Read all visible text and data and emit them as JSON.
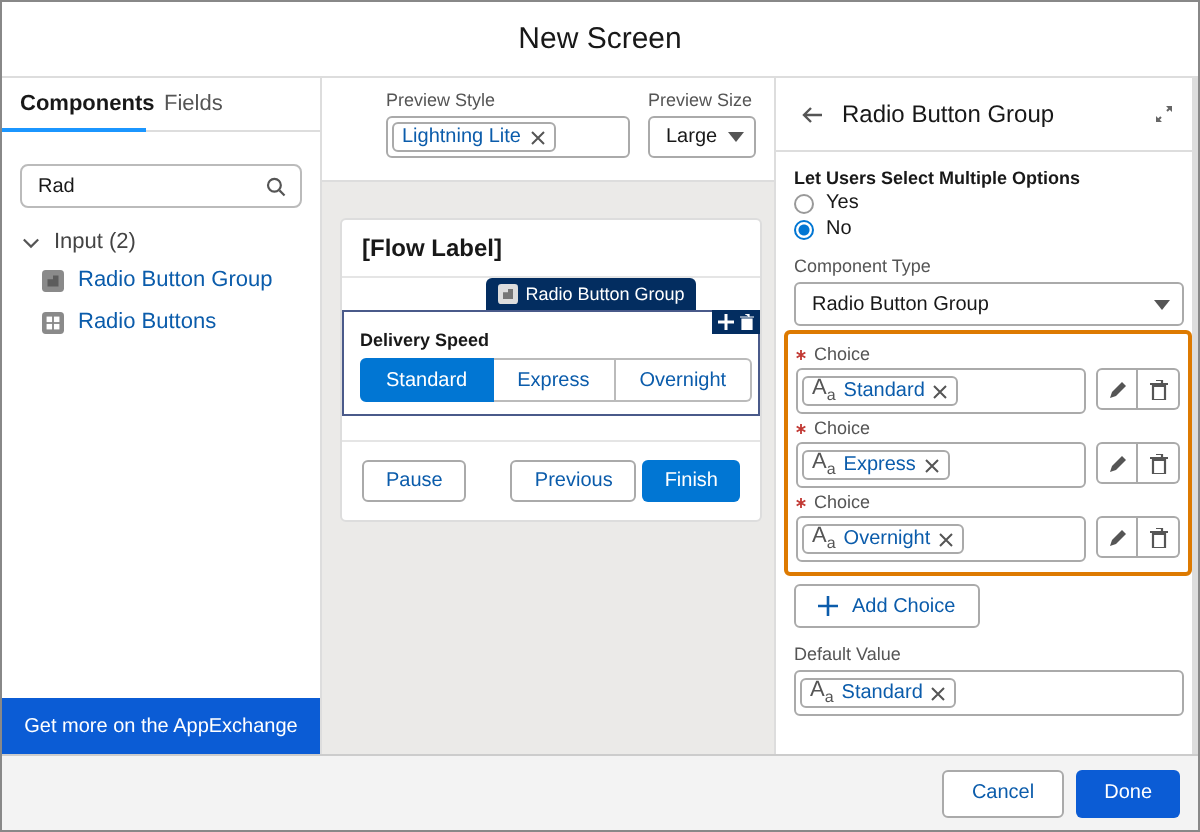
{
  "window": {
    "title": "New Screen"
  },
  "left_panel": {
    "tabs": [
      {
        "label": "Components",
        "selected": true
      },
      {
        "label": "Fields",
        "selected": false
      }
    ],
    "search": {
      "value": "Rad"
    },
    "tree": [
      {
        "label": "Input (2)",
        "expanded": true,
        "children": [
          {
            "label": "Radio Button Group",
            "kind": "group"
          },
          {
            "label": "Radio Buttons",
            "kind": "grid"
          }
        ]
      }
    ],
    "appexchange_button": "Get more on the AppExchange"
  },
  "preview": {
    "style_label": "Preview Style",
    "style_pill": "Lightning Lite",
    "size_label": "Preview Size",
    "size_value": "Large"
  },
  "canvas": {
    "title": "[Flow Label]",
    "component_tab": "Radio Button Group",
    "field_label": "Delivery Speed",
    "options": [
      {
        "label": "Standard",
        "selected": true
      },
      {
        "label": "Express",
        "selected": false
      },
      {
        "label": "Overnight",
        "selected": false
      }
    ],
    "left_buttons": [
      {
        "label": "Pause",
        "kind": "neutral"
      }
    ],
    "right_buttons": [
      {
        "label": "Previous",
        "kind": "neutral"
      },
      {
        "label": "Finish",
        "kind": "brand"
      }
    ]
  },
  "properties": {
    "title": "Radio Button Group",
    "multi_label": "Let Users Select Multiple Options",
    "multi_options": [
      {
        "label": "Yes",
        "selected": false
      },
      {
        "label": "No",
        "selected": true
      }
    ],
    "type_label": "Component Type",
    "type_value": "Radio Button Group",
    "highlighted": true,
    "choices": [
      {
        "label": "Choice",
        "required": true,
        "type_icon": "A$_{a}$",
        "value": "Standard"
      },
      {
        "label": "Choice",
        "required": true,
        "type_icon": "A$_{a}$",
        "value": "Express"
      },
      {
        "label": "Choice",
        "required": true,
        "type_icon": "A$_{a}$",
        "value": "Overnight"
      }
    ],
    "add_button": "Add Choice",
    "default_label": "Default Value",
    "default_type_icon": "A$_{a}$",
    "default_value": "Standard"
  },
  "footer": {
    "buttons": [
      {
        "label": "Cancel",
        "kind": "neutral"
      },
      {
        "label": "Done",
        "kind": "brand"
      }
    ]
  }
}
